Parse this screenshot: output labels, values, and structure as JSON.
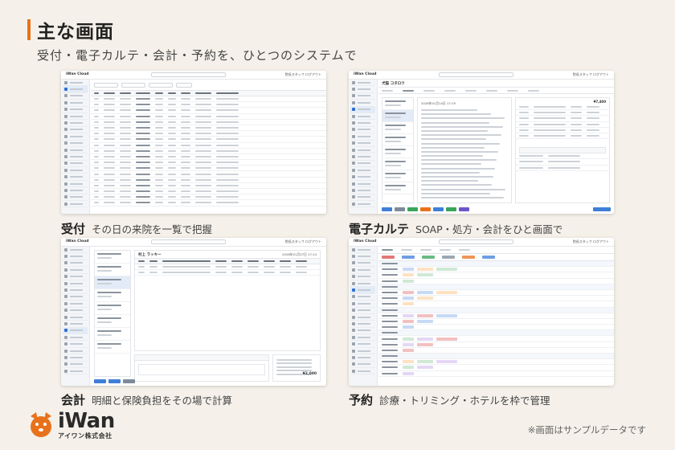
{
  "header": {
    "title": "主な画面",
    "subtitle": "受付・電子カルテ・会計・予約を、ひとつのシステムで"
  },
  "app": {
    "brand": "iWan Cloud",
    "user": "院長スタッフ  ログアウト"
  },
  "panels": [
    {
      "id": "reception",
      "caption_title": "受付",
      "caption_desc": "その日の来院を一覧で把握"
    },
    {
      "id": "emr",
      "caption_title": "電子カルテ",
      "caption_desc": "SOAP・処方・会計をひと画面で"
    },
    {
      "id": "billing",
      "caption_title": "会計",
      "caption_desc": "明細と保険負担をその場で計算"
    },
    {
      "id": "booking",
      "caption_title": "予約",
      "caption_desc": "診療・トリミング・ホテルを枠で管理"
    }
  ],
  "emr_screen": {
    "patient": "犬猫 コタロウ",
    "record_date": "2026年01月14日 17:19",
    "total": "¥7,400"
  },
  "billing_screen": {
    "patient": "村上 ラッキー",
    "date": "2026年01月27日 17:14",
    "total": "¥2,000"
  },
  "footer": {
    "logo_word": "iWan",
    "logo_sub": "アイワン株式会社",
    "note": "※画面はサンプルデータです"
  },
  "colors": {
    "accent": "#e8721c",
    "link": "#2f6fd0",
    "background": "#f5f1ea"
  }
}
